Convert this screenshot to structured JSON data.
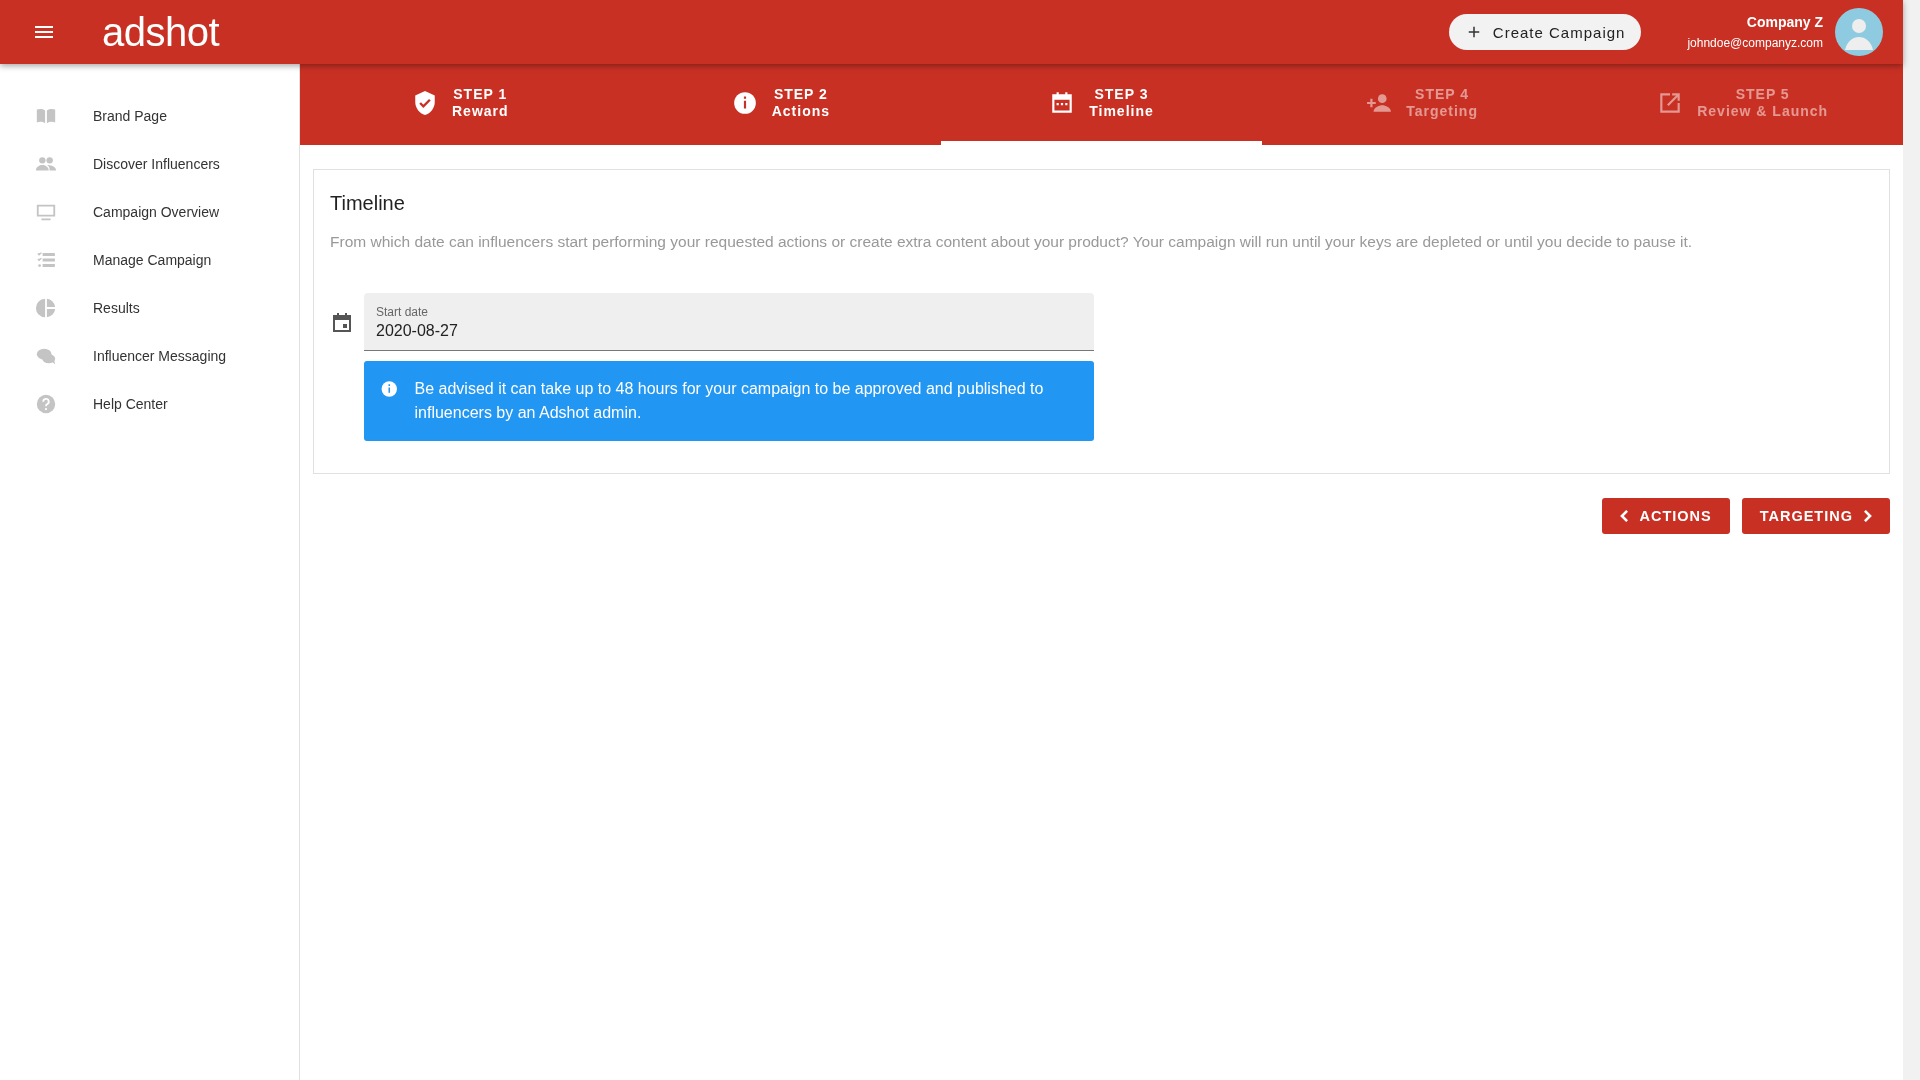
{
  "header": {
    "logo": "adshot",
    "create_button": "Create Campaign",
    "company": "Company Z",
    "email": "johndoe@companyz.com"
  },
  "sidebar": {
    "items": [
      {
        "label": "Brand Page"
      },
      {
        "label": "Discover Influencers"
      },
      {
        "label": "Campaign Overview"
      },
      {
        "label": "Manage Campaign"
      },
      {
        "label": "Results"
      },
      {
        "label": "Influencer Messaging"
      },
      {
        "label": "Help Center"
      }
    ]
  },
  "steps": [
    {
      "step": "STEP 1",
      "label": "Reward",
      "selected": false,
      "disabled": false
    },
    {
      "step": "STEP 2",
      "label": "Actions",
      "selected": false,
      "disabled": false
    },
    {
      "step": "STEP 3",
      "label": "Timeline",
      "selected": true,
      "disabled": false
    },
    {
      "step": "STEP 4",
      "label": "Targeting",
      "selected": false,
      "disabled": true
    },
    {
      "step": "STEP 5",
      "label": "Review & Launch",
      "selected": false,
      "disabled": true
    }
  ],
  "card": {
    "title": "Timeline",
    "description": "From which date can influencers start performing your requested actions or create extra content about your product? Your campaign will run until your keys are depleted or until you decide to pause it.",
    "start_date": {
      "label": "Start date",
      "value": "2020-08-27"
    },
    "alert": "Be advised it can take up to 48 hours for your campaign to be approved and published to influencers by an Adshot admin."
  },
  "buttons": {
    "back": "ACTIONS",
    "next": "TARGETING"
  }
}
